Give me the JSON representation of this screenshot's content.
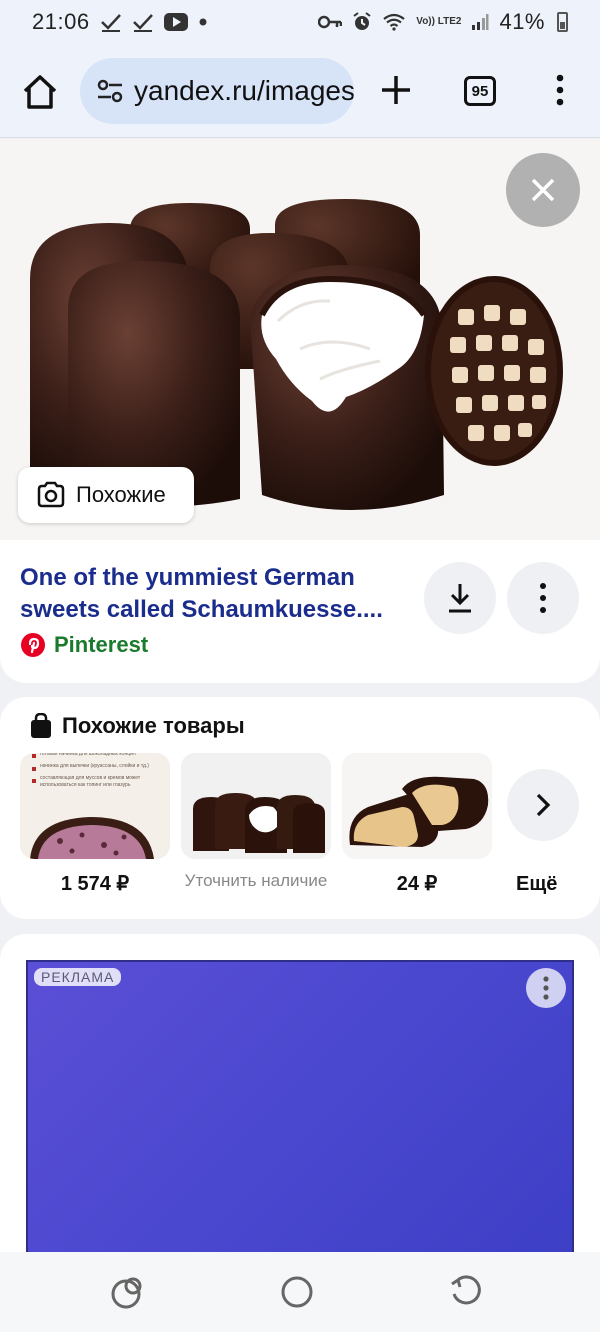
{
  "status_bar": {
    "time": "21:06",
    "battery": "41%",
    "icons_left": [
      "check-icon",
      "check-icon",
      "youtube-icon",
      "dot-icon"
    ],
    "icons_right": [
      "key-icon",
      "alarm-icon",
      "wifi-icon",
      "volte-icon",
      "signal-icon",
      "battery-icon"
    ],
    "volte_label": "Vo)) LTE2"
  },
  "browser": {
    "url": "yandex.ru/images",
    "tab_count": "95"
  },
  "image_view": {
    "similar_button_label": "Похожие"
  },
  "result": {
    "title_line1": "One of the yummiest German",
    "title_line2": "sweets called Schaumkuesse....",
    "source": "Pinterest"
  },
  "products": {
    "title": "Похожие товары",
    "items": [
      {
        "price": "1 574 ₽",
        "muted": false
      },
      {
        "price": "Уточнить наличие",
        "muted": true
      },
      {
        "price": "24 ₽",
        "muted": false
      }
    ],
    "more_label": "Ещё",
    "thumb1_lines": [
      "готовая начинка для шоколадных конфет",
      "начинка для выпечки (круассаны, слойки и тд.)",
      "составляющая для муссов и кремов может использоваться как топинг или глазурь"
    ]
  },
  "ad": {
    "label": "РЕКЛАМА"
  },
  "colors": {
    "title_link": "#1a2c8c",
    "source_green": "#1b7a2c",
    "ad_blue": "#4a48cf",
    "pinterest_red": "#e60023"
  }
}
